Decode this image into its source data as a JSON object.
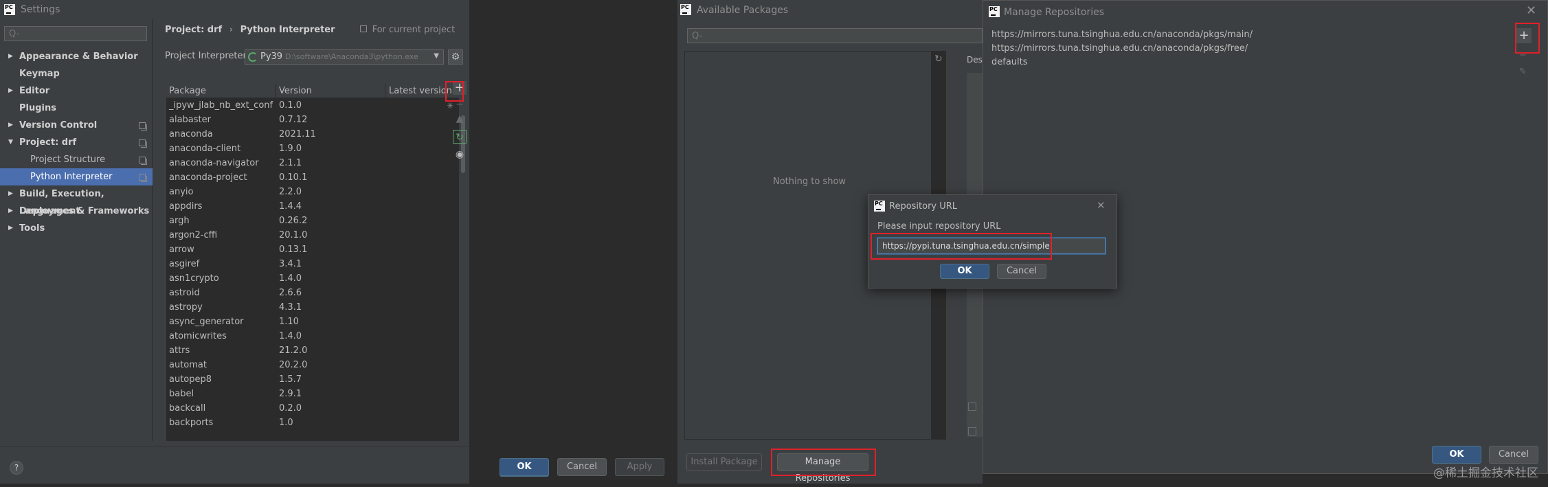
{
  "settings": {
    "title": "Settings",
    "search_placeholder": "Q-",
    "tree": [
      {
        "label": "Appearance & Behavior",
        "bold": true,
        "arrow": "right"
      },
      {
        "label": "Keymap",
        "bold": true,
        "arrow": ""
      },
      {
        "label": "Editor",
        "bold": true,
        "arrow": "right"
      },
      {
        "label": "Plugins",
        "bold": true,
        "arrow": ""
      },
      {
        "label": "Version Control",
        "bold": true,
        "arrow": "right"
      },
      {
        "label": "Project: drf",
        "bold": true,
        "arrow": "down"
      },
      {
        "label": "Project Structure",
        "bold": false,
        "arrow": ""
      },
      {
        "label": "Python Interpreter",
        "bold": false,
        "arrow": "",
        "selected": true
      },
      {
        "label": "Build, Execution, Deployment",
        "bold": true,
        "arrow": "right"
      },
      {
        "label": "Languages & Frameworks",
        "bold": true,
        "arrow": "right"
      },
      {
        "label": "Tools",
        "bold": true,
        "arrow": "right"
      }
    ],
    "breadcrumb": {
      "project": "Project: drf",
      "sep": "›",
      "page": "Python Interpreter",
      "scope": "For current project"
    },
    "interpreter_label": "Project Interpreter:",
    "interpreter_name": "Py39",
    "interpreter_path": "D:\\software\\Anaconda3\\python.exe",
    "table_headers": [
      "Package",
      "Version",
      "Latest version"
    ],
    "packages": [
      [
        "_ipyw_jlab_nb_ext_conf",
        "0.1.0"
      ],
      [
        "alabaster",
        "0.7.12"
      ],
      [
        "anaconda",
        "2021.11"
      ],
      [
        "anaconda-client",
        "1.9.0"
      ],
      [
        "anaconda-navigator",
        "2.1.1"
      ],
      [
        "anaconda-project",
        "0.10.1"
      ],
      [
        "anyio",
        "2.2.0"
      ],
      [
        "appdirs",
        "1.4.4"
      ],
      [
        "argh",
        "0.26.2"
      ],
      [
        "argon2-cffi",
        "20.1.0"
      ],
      [
        "arrow",
        "0.13.1"
      ],
      [
        "asgiref",
        "3.4.1"
      ],
      [
        "asn1crypto",
        "1.4.0"
      ],
      [
        "astroid",
        "2.6.6"
      ],
      [
        "astropy",
        "4.3.1"
      ],
      [
        "async_generator",
        "1.10"
      ],
      [
        "atomicwrites",
        "1.4.0"
      ],
      [
        "attrs",
        "21.2.0"
      ],
      [
        "automat",
        "20.2.0"
      ],
      [
        "autopep8",
        "1.5.7"
      ],
      [
        "babel",
        "2.9.1"
      ],
      [
        "backcall",
        "0.2.0"
      ],
      [
        "backports",
        "1.0"
      ]
    ],
    "ok": "OK",
    "cancel": "Cancel",
    "apply": "Apply",
    "help": "?"
  },
  "available": {
    "title": "Available Packages",
    "search_placeholder": "Q-",
    "empty": "Nothing to show",
    "desc_header": "Desc",
    "install": "Install Package",
    "manage": "Manage Repositories"
  },
  "manage_repos": {
    "title": "Manage Repositories",
    "repos": [
      "https://mirrors.tuna.tsinghua.edu.cn/anaconda/pkgs/main/",
      "https://mirrors.tuna.tsinghua.edu.cn/anaconda/pkgs/free/",
      "defaults"
    ],
    "ok": "OK",
    "cancel": "Cancel"
  },
  "repo_url_dialog": {
    "title": "Repository URL",
    "prompt": "Please input repository URL",
    "value": "https://pypi.tuna.tsinghua.edu.cn/simple",
    "ok": "OK",
    "cancel": "Cancel"
  },
  "watermark": "@稀土掘金技术社区",
  "colors": {
    "accent_red": "#e0202a",
    "selection": "#4b6eaf",
    "primary_button": "#365880"
  }
}
